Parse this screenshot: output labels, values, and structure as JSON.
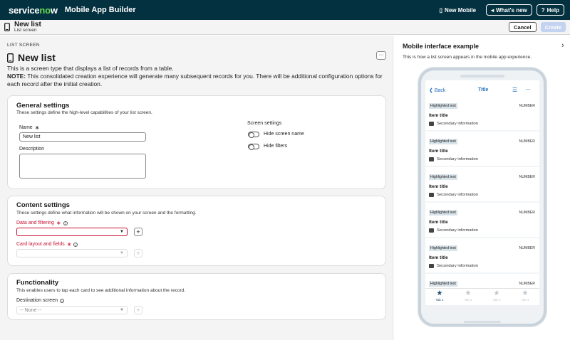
{
  "header": {
    "brand_prefix": "service",
    "brand_o": "n",
    "brand_suffix": "w",
    "app_name": "Mobile App Builder",
    "new_mobile": "New Mobile",
    "whats_new": "What's new",
    "help": "Help"
  },
  "subheader": {
    "title": "New list",
    "caption": "List screen",
    "cancel": "Cancel",
    "create": "Create"
  },
  "main": {
    "section_caption": "LIST SCREEN",
    "page_title": "New list",
    "more": "···",
    "desc_line1": "This is a screen type that displays a list of records from a table.",
    "note_label": "NOTE:",
    "note_text": " This consolidated creation experience will generate many subsequent records for you. There will be additional configuration options for each record after the initial creation."
  },
  "general": {
    "title": "General settings",
    "subtitle": "These settings define the high-level capabilities of your list screen.",
    "name_label": "Name",
    "name_value": "New list",
    "description_label": "Description",
    "screen_settings_label": "Screen settings",
    "hide_screen_name": "Hide screen name",
    "hide_filters": "Hide filters"
  },
  "content": {
    "title": "Content settings",
    "subtitle": "These settings define what information will be shown on your screen and the formatting.",
    "data_filtering_label": "Data and filtering",
    "card_layout_label": "Card layout and fields"
  },
  "functionality": {
    "title": "Functionality",
    "subtitle": "This enables users to tap each card to see additional information about the record.",
    "destination_label": "Destination screen",
    "destination_value": "-- None --"
  },
  "preview": {
    "title": "Mobile interface example",
    "subtitle": "This is how a list screen appears in the mobile app experience.",
    "back": "Back",
    "nav_title": "Title",
    "items": [
      {
        "highlight": "Highlighted text",
        "number": "NUMBER",
        "title": "Item title",
        "secondary": "Secondary information"
      },
      {
        "highlight": "Highlighted text",
        "number": "NUMBER",
        "title": "Item title",
        "secondary": "Secondary information"
      },
      {
        "highlight": "Highlighted text",
        "number": "NUMBER",
        "title": "Item title",
        "secondary": "Secondary information"
      },
      {
        "highlight": "Highlighted text",
        "number": "NUMBER",
        "title": "Item title",
        "secondary": "Secondary information"
      },
      {
        "highlight": "Highlighted text",
        "number": "NUMBER",
        "title": "Item title",
        "secondary": "Secondary information"
      },
      {
        "highlight": "Highlighted text",
        "number": "NUMBER",
        "title": "",
        "secondary": ""
      }
    ],
    "tabs": [
      "Tab 1",
      "Tab 2",
      "Tab 3",
      "Tab 4"
    ]
  },
  "colors": {
    "header_bg": "#03313f",
    "brand_accent": "#62d84e",
    "required_red": "#c8102e",
    "link_blue": "#1f6fbf"
  }
}
